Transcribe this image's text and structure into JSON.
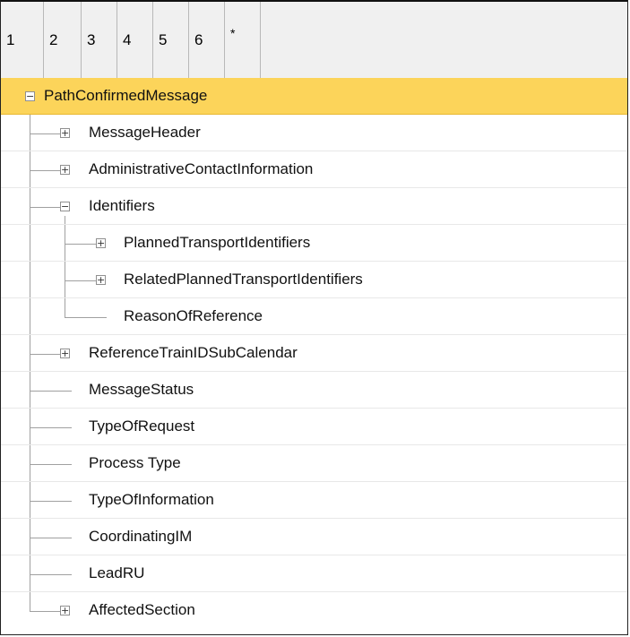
{
  "level_buttons": [
    "1",
    "2",
    "3",
    "4",
    "5",
    "6",
    "*"
  ],
  "tree": {
    "root": {
      "label": "PathConfirmedMessage",
      "expander": "−"
    },
    "message_header": {
      "label": "MessageHeader",
      "expander": "+"
    },
    "admin_contact": {
      "label": "AdministrativeContactInformation",
      "expander": "+"
    },
    "identifiers": {
      "label": "Identifiers",
      "expander": "−"
    },
    "planned_transport_ids": {
      "label": "PlannedTransportIdentifiers",
      "expander": "+"
    },
    "related_planned_transport_ids": {
      "label": "RelatedPlannedTransportIdentifiers",
      "expander": "+"
    },
    "reason_of_reference": {
      "label": "ReasonOfReference"
    },
    "reference_train_id": {
      "label": "ReferenceTrainIDSubCalendar",
      "expander": "+"
    },
    "message_status": {
      "label": "MessageStatus"
    },
    "type_of_request": {
      "label": "TypeOfRequest"
    },
    "process_type": {
      "label": "Process Type"
    },
    "type_of_information": {
      "label": "TypeOfInformation"
    },
    "coordinating_im": {
      "label": "CoordinatingIM"
    },
    "lead_ru": {
      "label": "LeadRU"
    },
    "affected_section": {
      "label": "AffectedSection",
      "expander": "+"
    }
  },
  "colors": {
    "selected_row": "#fcd45a",
    "tree_lines": "#a0a0a0"
  }
}
